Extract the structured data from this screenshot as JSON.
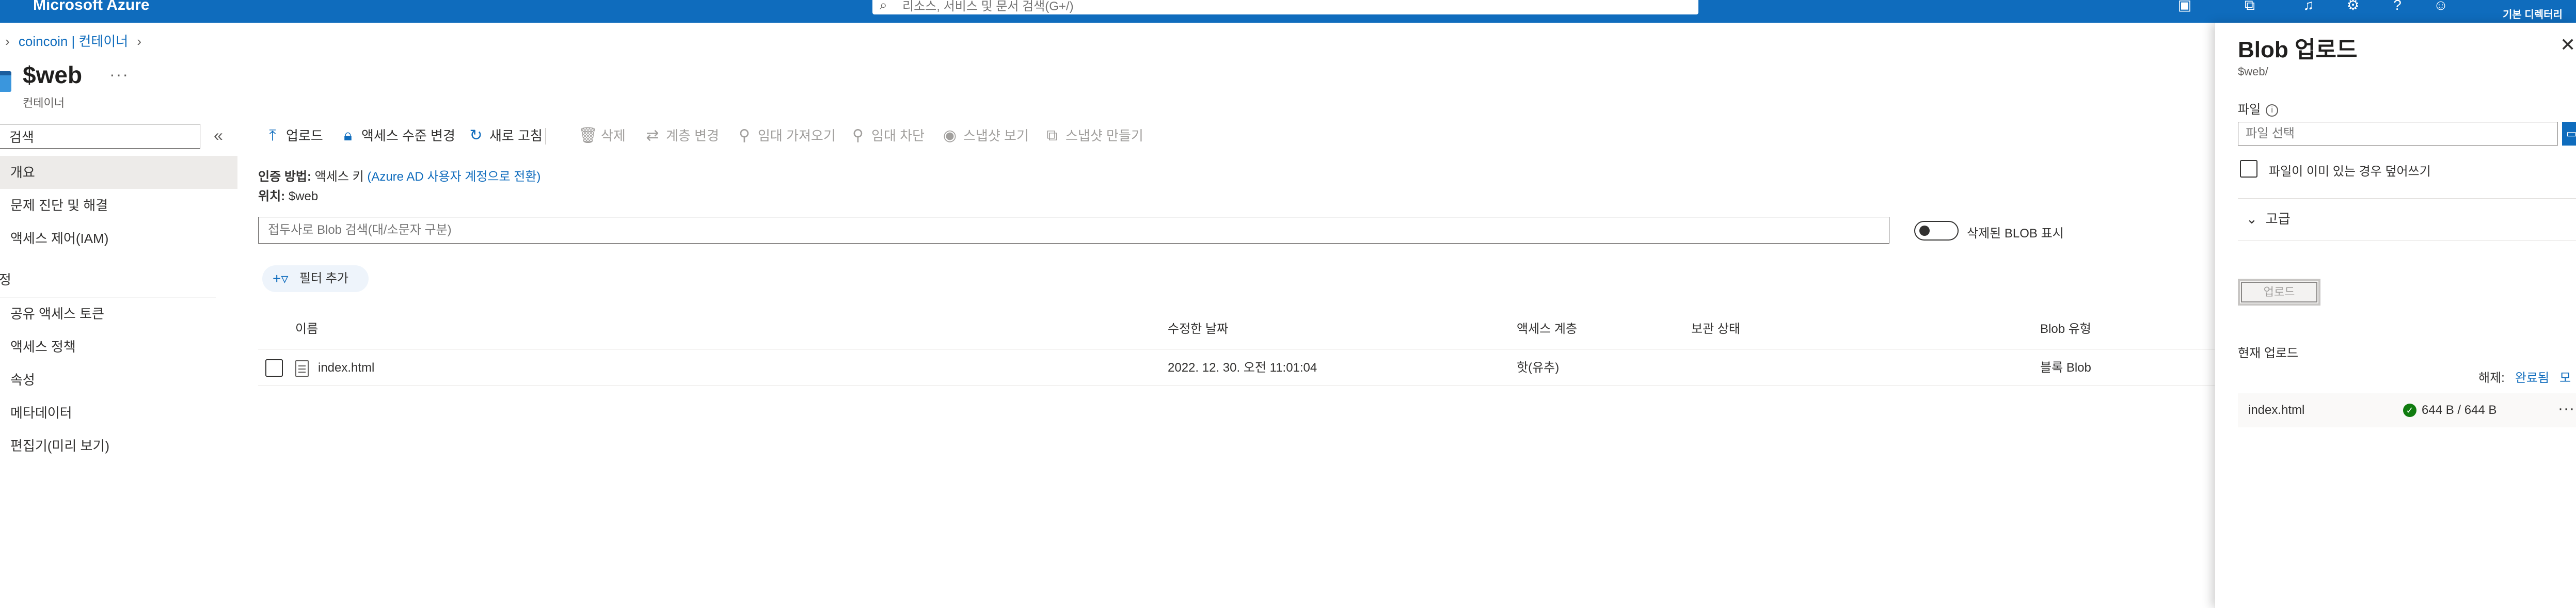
{
  "topbar": {
    "brand": "Microsoft Azure",
    "search_placeholder": "리소스, 서비스 및 문서 검색(G+/)",
    "user_directory": "기본 디렉터리",
    "icons": [
      "cloud-shell-icon",
      "directory-filter-icon",
      "notifications-icon",
      "settings-icon",
      "help-icon",
      "feedback-icon"
    ]
  },
  "breadcrumb": {
    "items": [
      "coincoin | 컨테이너"
    ]
  },
  "page": {
    "title": "$web",
    "subtitle": "컨테이너"
  },
  "nav": {
    "search_value": "검색",
    "items_top": [
      "개요",
      "문제 진단 및 해결",
      "액세스 제어(IAM)"
    ],
    "section": "설정",
    "items_settings": [
      "공유 액세스 토큰",
      "액세스 정책",
      "속성",
      "메타데이터",
      "편집기(미리 보기)"
    ]
  },
  "commands": {
    "upload": "업로드",
    "change_tier": "액세스 수준 변경",
    "refresh": "새로 고침",
    "delete": "삭제",
    "change_layer": "계층 변경",
    "acquire_lease": "임대 가져오기",
    "break_lease": "임대 차단",
    "view_snapshots": "스냅샷 보기",
    "create_snapshot": "스냅샷 만들기"
  },
  "info": {
    "auth_label": "인증 방법:",
    "auth_value": "액세스 키",
    "auth_link": "(Azure AD 사용자 계정으로 전환)",
    "location_label": "위치:",
    "location_value": "$web"
  },
  "blob_search": {
    "placeholder": "접두사로 Blob 검색(대/소문자 구분)"
  },
  "toggle": {
    "label": "삭제된 BLOB 표시",
    "on": false
  },
  "filter": {
    "label": "필터 추가"
  },
  "table": {
    "headers": [
      "이름",
      "수정한 날짜",
      "액세스 계층",
      "보관 상태",
      "Blob 유형"
    ],
    "rows": [
      {
        "name": "index.html",
        "modified": "2022. 12. 30. 오전 11:01:04",
        "tier": "핫(유추)",
        "archive": "",
        "type": "블록 Blob"
      }
    ]
  },
  "panel": {
    "title": "Blob 업로드",
    "path": "$web/",
    "file_label": "파일",
    "file_placeholder": "파일 선택",
    "overwrite_label": "파일이 이미 있는 경우 덮어쓰기",
    "advanced_label": "고급",
    "upload_button": "업로드",
    "current_uploads_label": "현재 업로드",
    "clear_label": "해제:",
    "clear_completed": "완료됨",
    "clear_all": "모",
    "uploads": [
      {
        "name": "index.html",
        "progress": "644 B / 644 B",
        "status": "completed"
      }
    ]
  },
  "colors": {
    "accent": "#0f6cbd",
    "success": "#107c10",
    "selected_nav": "#edebe9"
  }
}
